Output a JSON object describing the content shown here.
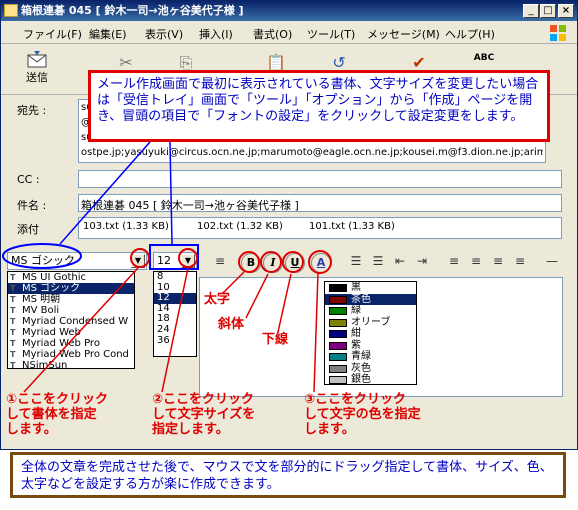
{
  "window": {
    "title": "箱根連碁 045 [ 鈴木一司→池ヶ谷美代子様 ]"
  },
  "menu": [
    "ファイル(F)",
    "編集(E)",
    "表示(V)",
    "挿入(I)",
    "書式(O)",
    "ツール(T)",
    "メッセージ(M)",
    "ヘルプ(H)"
  ],
  "toolbar": {
    "send_label": "送信",
    "spell_label": "ABC"
  },
  "fields": {
    "to_label": "宛先 :",
    "to_lines": [
      "su",
      "@c",
      "su",
      "ostpe.jp;yasuyuki@circus.ocn.ne.jp;marumoto@eagle.ocn.ne.jp;kousei.m@f3.dion.ne.jp;arimasa.to"
    ],
    "cc_label": "CC :",
    "subject_label": "件名 :",
    "subject_value": "箱根連碁 045 [ 鈴木一司→池ヶ谷美代子様 ]",
    "attach_label": "添付",
    "attachments": [
      "103.txt (1.33 KB)",
      "102.txt (1.32 KB)",
      "101.txt (1.33 KB)"
    ]
  },
  "callout_top": "メール作成画面で最初に表示されている書体、文字サイズを変更したい場合は「受信トレイ」画面で「ツール」「オプション」から「作成」ページを開き、冒頭の項目で「フォントの設定」をクリックして設定変更をします。",
  "format": {
    "font_value": "MS ゴシック",
    "size_value": "12",
    "bold": "B",
    "italic": "I",
    "underline": "U",
    "color": "A"
  },
  "font_list": [
    "MS UI Gothic",
    "MS ゴシック",
    "MS 明朝",
    "MV Boli",
    "Myriad Condensed W",
    "Myriad Web",
    "Myriad Web Pro",
    "Myriad Web Pro Cond",
    "NSimSun"
  ],
  "size_list": [
    "8",
    "10",
    "12",
    "14",
    "18",
    "24",
    "36"
  ],
  "color_list": [
    {
      "name": "黒",
      "color": "#000000"
    },
    {
      "name": "茶色",
      "color": "#800000"
    },
    {
      "name": "緑",
      "color": "#008000"
    },
    {
      "name": "オリーブ",
      "color": "#808000"
    },
    {
      "name": "紺",
      "color": "#000080"
    },
    {
      "name": "紫",
      "color": "#800080"
    },
    {
      "name": "青緑",
      "color": "#008080"
    },
    {
      "name": "灰色",
      "color": "#808080"
    },
    {
      "name": "銀色",
      "color": "#c0c0c0"
    }
  ],
  "annotations": {
    "bold": "太字",
    "italic": "斜体",
    "underline": "下線",
    "step1": [
      "①ここをクリック",
      "して書体を指定",
      "します。"
    ],
    "step2": [
      "②ここをクリック",
      "して文字サイズを",
      "指定します。"
    ],
    "step3": [
      "③ここをクリック",
      "して文字の色を指定",
      "します。"
    ]
  },
  "callout_bottom": "全体の文章を完成させた後で、マウスで文を部分的にドラッグ指定して書体、サイズ、色、太字などを設定する方が楽に作成できます。"
}
